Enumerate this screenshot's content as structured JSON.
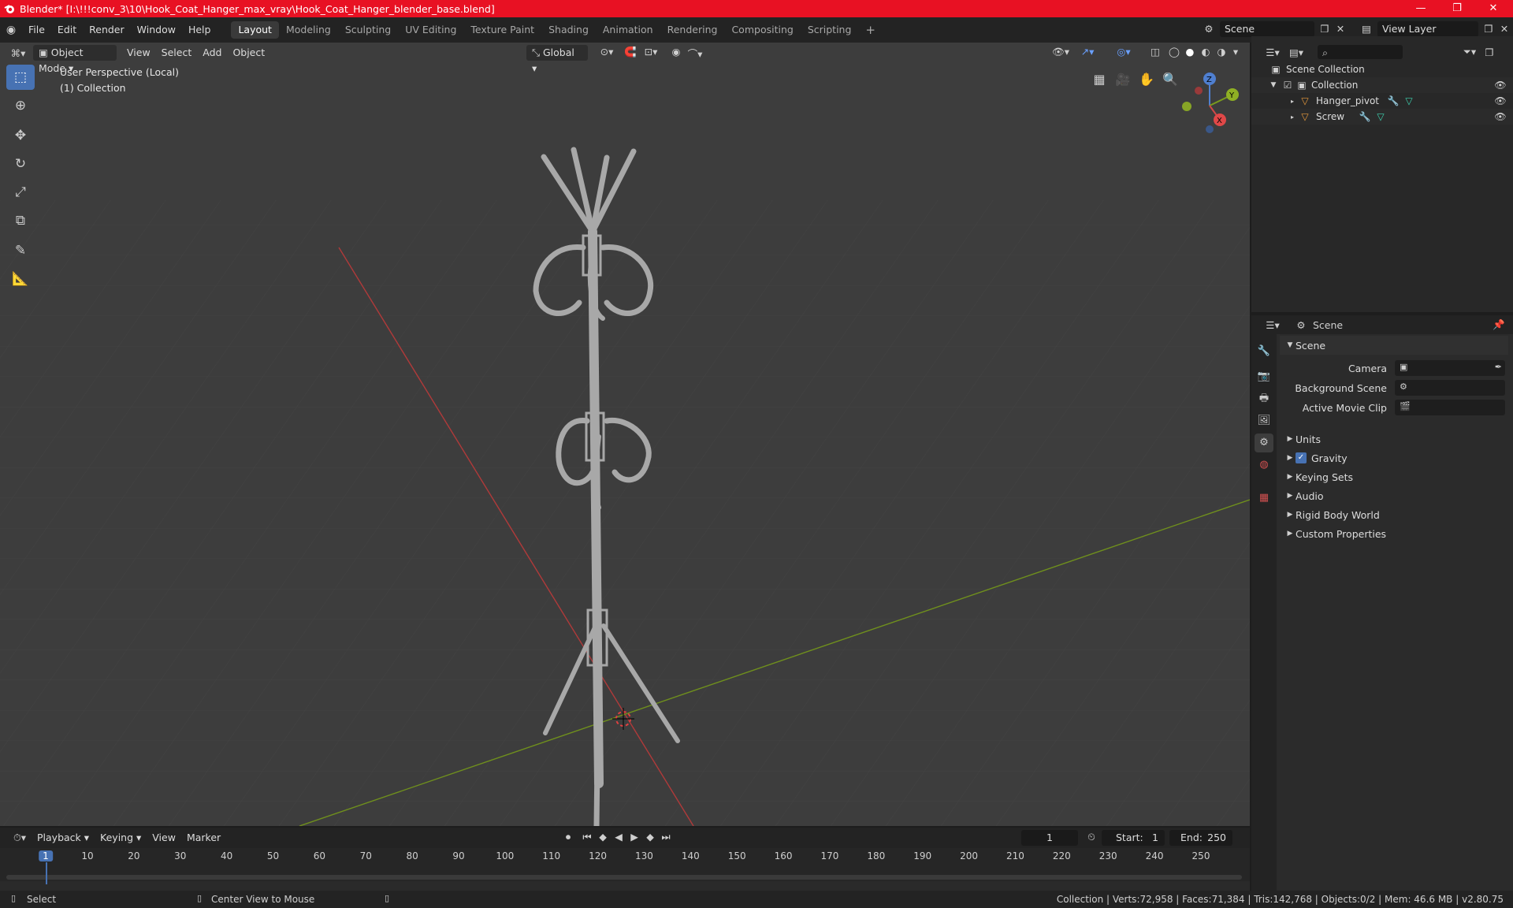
{
  "window": {
    "title": "Blender* [I:\\!!!conv_3\\10\\Hook_Coat_Hanger_max_vray\\Hook_Coat_Hanger_blender_base.blend]"
  },
  "menu": [
    "File",
    "Edit",
    "Render",
    "Window",
    "Help"
  ],
  "workspaces": [
    "Layout",
    "Modeling",
    "Sculpting",
    "UV Editing",
    "Texture Paint",
    "Shading",
    "Animation",
    "Rendering",
    "Compositing",
    "Scripting"
  ],
  "active_workspace": "Layout",
  "scene_field": "Scene",
  "view_layer_field": "View Layer",
  "viewport_header": {
    "mode": "Object Mode",
    "menus": [
      "View",
      "Select",
      "Add",
      "Object"
    ],
    "transform": "Global"
  },
  "viewport_overlay": {
    "perspective": "User Perspective (Local)",
    "collection": "(1) Collection"
  },
  "gizmo": {
    "z": "Z",
    "y": "Y",
    "x": "X"
  },
  "outliner": {
    "root": "Scene Collection",
    "collection": "Collection",
    "objects": [
      "Hanger_pivot",
      "Screw"
    ]
  },
  "properties": {
    "breadcrumb": "Scene",
    "panel_title": "Scene",
    "camera_label": "Camera",
    "background_scene_label": "Background Scene",
    "active_movie_clip_label": "Active Movie Clip",
    "sections": [
      "Units",
      "Gravity",
      "Keying Sets",
      "Audio",
      "Rigid Body World",
      "Custom Properties"
    ],
    "gravity_checked": true
  },
  "timeline": {
    "menus": [
      "Playback",
      "Keying",
      "View",
      "Marker"
    ],
    "current_frame": "1",
    "start_label": "Start:",
    "start": "1",
    "end_label": "End:",
    "end": "250",
    "ticks": [
      "1",
      "10",
      "20",
      "30",
      "40",
      "50",
      "60",
      "70",
      "80",
      "90",
      "100",
      "110",
      "120",
      "130",
      "140",
      "150",
      "160",
      "170",
      "180",
      "190",
      "200",
      "210",
      "220",
      "230",
      "240",
      "250"
    ]
  },
  "statusbar": {
    "left": "Select",
    "middle": "Center View to Mouse",
    "right": "Collection | Verts:72,958 | Faces:71,384 | Tris:142,768 | Objects:0/2 | Mem: 46.6 MB | v2.80.75"
  },
  "colors": {
    "accent": "#4772b3",
    "titlebar": "#e81123",
    "x_axis": "#c23b3b",
    "y_axis": "#7a9a1e"
  }
}
